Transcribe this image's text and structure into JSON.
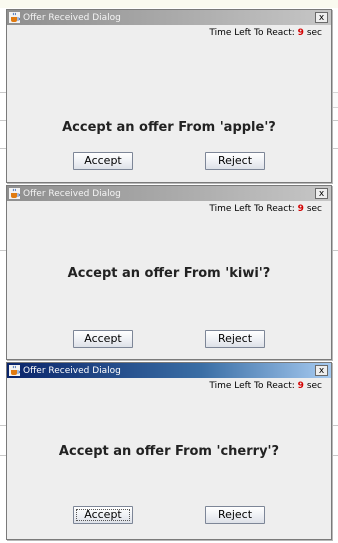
{
  "dialogs": [
    {
      "title": "Offer Received Dialog",
      "close_label": "x",
      "timer_label": "Time Left To React:",
      "timer_value": "9",
      "timer_unit": "sec",
      "question": "Accept an offer From 'apple'?",
      "accept_label": "Accept",
      "reject_label": "Reject",
      "state": "inactive"
    },
    {
      "title": "Offer Received Dialog",
      "close_label": "x",
      "timer_label": "Time Left To React:",
      "timer_value": "9",
      "timer_unit": "sec",
      "question": "Accept an offer From 'kiwi'?",
      "accept_label": "Accept",
      "reject_label": "Reject",
      "state": "inactive"
    },
    {
      "title": "Offer Received Dialog",
      "close_label": "x",
      "timer_label": "Time Left To React:",
      "timer_value": "9",
      "timer_unit": "sec",
      "question": "Accept an offer From 'cherry'?",
      "accept_label": "Accept",
      "reject_label": "Reject",
      "state": "active"
    }
  ],
  "colors": {
    "timer_value": "#d40000",
    "active_title_start": "#0a246a",
    "active_title_end": "#a6caf0",
    "inactive_title_start": "#8f8f8f",
    "inactive_title_end": "#c6c6c6",
    "dialog_background": "#eeeeee"
  },
  "icons": {
    "title_icon": "java-cup-icon",
    "close_icon": "close-icon"
  }
}
